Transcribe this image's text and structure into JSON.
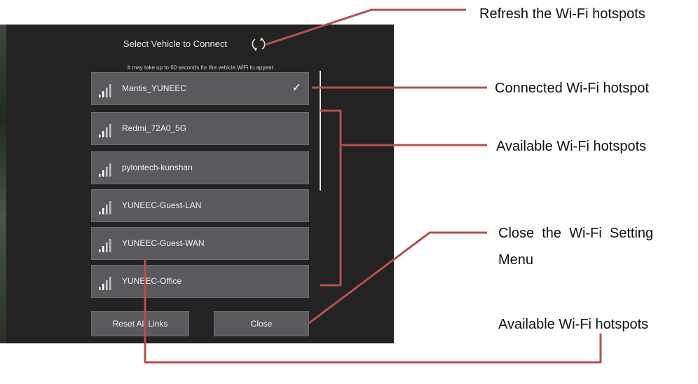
{
  "dialog": {
    "title": "Select Vehicle to Connect",
    "note": "It may take up to 60 seconds for the vehicle WiFi to appear.",
    "networks": [
      {
        "name": "Mantis_YUNEEC",
        "connected": true
      },
      {
        "name": "Redmi_72A0_5G",
        "connected": false
      },
      {
        "name": "pylontech-kunshan",
        "connected": false
      },
      {
        "name": "YUNEEC-Guest-LAN",
        "connected": false
      },
      {
        "name": "YUNEEC-Guest-WAN",
        "connected": false
      },
      {
        "name": "YUNEEC-Office",
        "connected": false
      }
    ],
    "checkmark": "✓",
    "reset_label": "Reset All Links",
    "close_label": "Close"
  },
  "annotations": {
    "refresh": "Refresh the Wi-Fi hotspots",
    "connected": "Connected Wi-Fi hotspot",
    "available": "Available Wi-Fi hotspots",
    "close_line1": "Close  the  Wi-Fi  Setting",
    "close_line2": "Menu",
    "reset": "Available Wi-Fi hotspots"
  },
  "colors": {
    "panel": "#232323",
    "row": "#5a5a5e",
    "annotation_line": "#b7504b"
  },
  "icons": {
    "refresh": "refresh-icon",
    "signal": "wifi-signal-icon",
    "check": "checkmark-icon"
  }
}
